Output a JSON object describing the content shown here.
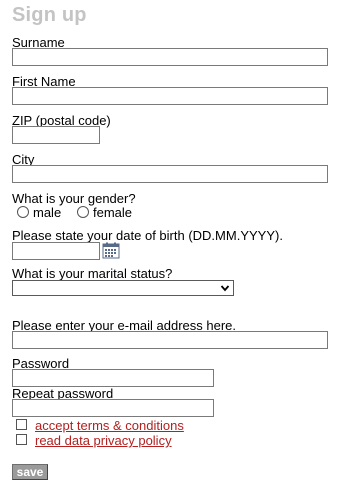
{
  "form": {
    "title": "Sign up",
    "surname": {
      "label": "Surname",
      "value": ""
    },
    "first_name": {
      "label": "First Name",
      "value": ""
    },
    "zip": {
      "label": "ZIP (postal code)",
      "value": ""
    },
    "city": {
      "label": "City",
      "value": ""
    },
    "gender": {
      "label": "What is your gender?",
      "options": [
        "male",
        "female"
      ],
      "selected": ""
    },
    "dob": {
      "label": "Please state your date of birth (DD.MM.YYYY).",
      "value": ""
    },
    "marital": {
      "label": "What is your marital status?",
      "selected": ""
    },
    "email": {
      "label": "Please enter your e-mail address here.",
      "value": ""
    },
    "password": {
      "label": "Password",
      "value": ""
    },
    "repeat_password": {
      "label": "Repeat password",
      "value": ""
    },
    "terms": {
      "label": "accept terms & conditions",
      "checked": false
    },
    "privacy": {
      "label": "read data privacy policy",
      "checked": false
    },
    "save_label": "save"
  },
  "colors": {
    "title": "#c4c4c4",
    "link": "#b32020",
    "button_bg": "#9b9b9b",
    "calendar_icon": "#5a6b8a"
  },
  "icons": {
    "calendar": "calendar-icon",
    "select_chevron": "chevron-down-icon"
  }
}
